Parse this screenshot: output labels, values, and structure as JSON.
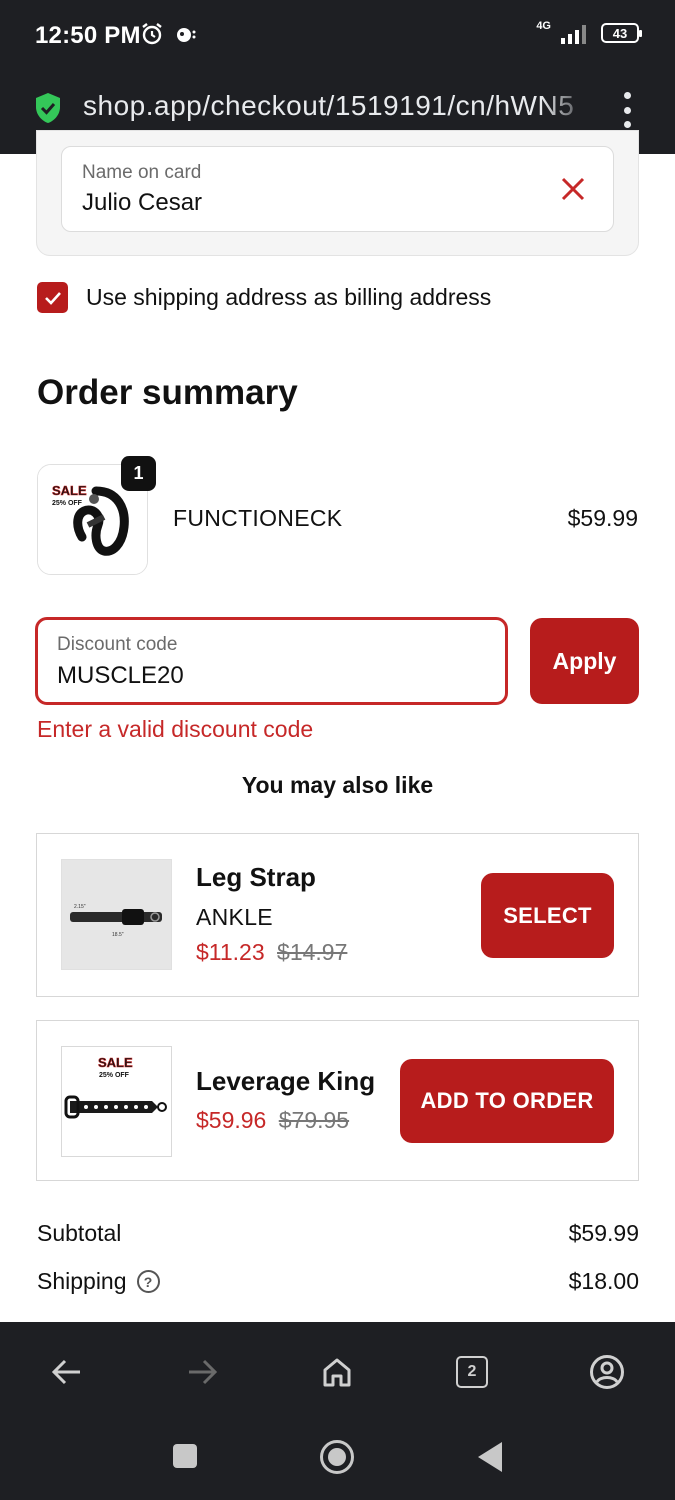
{
  "status_bar": {
    "time": "12:50 PM",
    "network": "4G",
    "battery": "43",
    "icons": [
      "alarm-icon",
      "notification-icon",
      "signal-icon",
      "battery-icon"
    ]
  },
  "browser": {
    "url": "shop.app/checkout/1519191/cn/hWN5",
    "security_icon": "shield-check-icon",
    "tab_count": "2"
  },
  "payment": {
    "name_label": "Name on card",
    "name_value": "Julio Cesar",
    "billing_checkbox_label": "Use shipping address as billing address",
    "billing_checked": true
  },
  "order_summary": {
    "title": "Order summary",
    "items": [
      {
        "name": "FUNCTIONECK",
        "price": "$59.99",
        "quantity": "1",
        "image_badge": "SALE",
        "image_badge_sub": "25% OFF"
      }
    ],
    "discount": {
      "label": "Discount code",
      "value": "MUSCLE20",
      "apply_label": "Apply",
      "error": "Enter a valid discount code"
    }
  },
  "upsell": {
    "heading": "You may also like",
    "products": [
      {
        "title": "Leg Strap",
        "variant": "ANKLE",
        "sale_price": "$11.23",
        "original_price": "$14.97",
        "button": "SELECT",
        "dim_a": "2.15\"",
        "dim_b": "18.5\""
      },
      {
        "title": "Leverage King",
        "sale_price": "$59.96",
        "original_price": "$79.95",
        "button": "ADD TO ORDER",
        "image_badge": "SALE",
        "image_badge_sub": "25% OFF"
      }
    ]
  },
  "totals": {
    "subtotal_label": "Subtotal",
    "subtotal_value": "$59.99",
    "shipping_label": "Shipping",
    "shipping_value": "$18.00",
    "help_glyph": "?"
  },
  "colors": {
    "brand_red": "#b71c1c",
    "error_red": "#c62828",
    "chrome_dark": "#1e1f23",
    "shield_green": "#34c759"
  }
}
